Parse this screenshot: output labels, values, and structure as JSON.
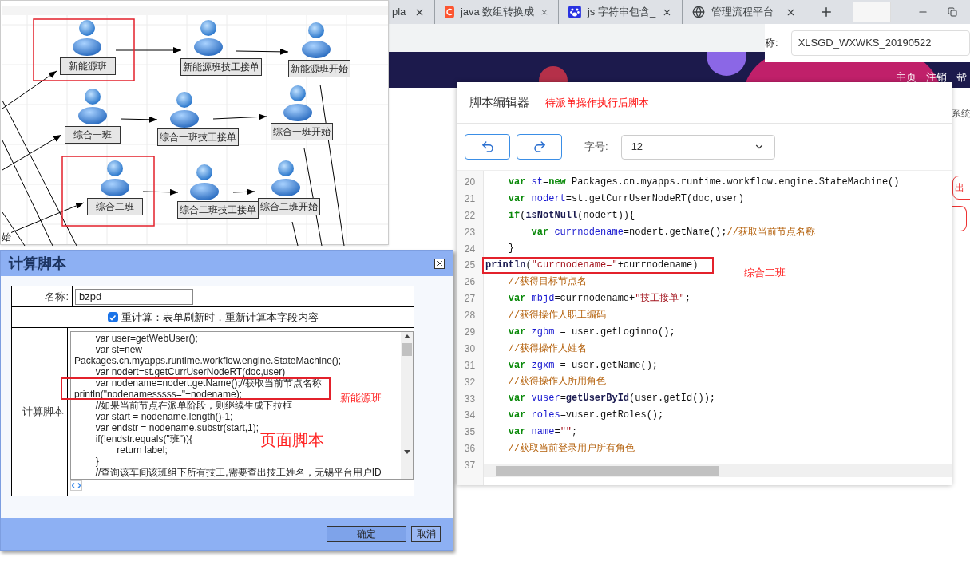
{
  "browser": {
    "tabs": [
      {
        "kind": "plain",
        "title": "pla"
      },
      {
        "kind": "c-logo",
        "title": "java 数组转换成"
      },
      {
        "kind": "paw",
        "title": "js 字符串包含_"
      },
      {
        "kind": "globe",
        "title": "管理流程平台"
      }
    ],
    "login": {
      "label": "称:",
      "value": "XLSGD_WXWKS_20190522"
    },
    "nav": [
      "主页",
      "注销",
      "帮"
    ],
    "side_text": "系统",
    "side_button": "出"
  },
  "diagram": {
    "nodes": [
      {
        "label": "新能源班",
        "highlighted": true
      },
      {
        "label": "新能源班技工接单",
        "highlighted": false
      },
      {
        "label": "新能源班开始",
        "highlighted": false
      },
      {
        "label": "综合一班",
        "highlighted": false
      },
      {
        "label": "综合一班技工接单",
        "highlighted": false
      },
      {
        "label": "综合一班开始",
        "highlighted": false
      },
      {
        "label": "综合二班",
        "highlighted": true
      },
      {
        "label": "综合二班技工接单",
        "highlighted": false
      },
      {
        "label": "综合二班开始",
        "highlighted": false
      }
    ],
    "edge_text": "始"
  },
  "calc_dialog": {
    "title": "计算脚本",
    "name_label": "名称:",
    "name_value": "bzpd",
    "recalc": {
      "checked": true,
      "label": "重计算：表单刷新时，重新计算本字段内容"
    },
    "script_label": "计算脚本",
    "script_lines": [
      "        var user=getWebUser();",
      "        var st=new",
      "Packages.cn.myapps.runtime.workflow.engine.StateMachine();",
      "        var nodert=st.getCurrUserNodeRT(doc,user)",
      "        var nodename=nodert.getName();//获取当前节点名称",
      "println(\"nodenamesssss=\"+nodename);",
      "        //如果当前节点在派单阶段，则继续生成下拉框",
      "        var start = nodename.length()-1;",
      "        var endstr = nodename.substr(start,1);",
      "        if(!endstr.equals(\"班\")){",
      "                return label;",
      "        }",
      "        //查询该车间该班组下所有技工,需要查出技工姓名，无锡平台用户ID"
    ],
    "annotation": "新能源班",
    "big_annotation": "页面脚本",
    "buttons": [
      "确定",
      "取消"
    ]
  },
  "editor": {
    "title": "脚本编辑器",
    "subtitle": "待派单操作执行后脚本",
    "font_label": "字号:",
    "font_size": "12",
    "annotation": "综合二班",
    "lines": [
      {
        "number": "20",
        "highlighted": false,
        "tokens": [
          {
            "kind": "keyword",
            "t": "    var "
          },
          {
            "kind": "variable",
            "t": "st"
          },
          {
            "kind": "plain",
            "t": "="
          },
          {
            "kind": "keyword",
            "t": "new"
          },
          {
            "kind": "plain",
            "t": " Packages.cn.myapps.runtime.workflow.engine.StateMachine()"
          }
        ]
      },
      {
        "number": "21",
        "highlighted": false,
        "tokens": [
          {
            "kind": "keyword",
            "t": "    var "
          },
          {
            "kind": "variable",
            "t": "nodert"
          },
          {
            "kind": "plain",
            "t": "=st.getCurrUserNodeRT(doc,user)"
          }
        ]
      },
      {
        "number": "22",
        "highlighted": false,
        "tokens": [
          {
            "kind": "keyword",
            "t": "    if"
          },
          {
            "kind": "plain",
            "t": "("
          },
          {
            "kind": "function",
            "t": "isNotNull"
          },
          {
            "kind": "plain",
            "t": "(nodert)){"
          }
        ]
      },
      {
        "number": "23",
        "highlighted": false,
        "tokens": [
          {
            "kind": "keyword",
            "t": "        var "
          },
          {
            "kind": "variable",
            "t": "currnodename"
          },
          {
            "kind": "plain",
            "t": "=nodert.getName();"
          },
          {
            "kind": "comment",
            "t": "//获取当前节点名称"
          }
        ]
      },
      {
        "number": "24",
        "highlighted": false,
        "tokens": [
          {
            "kind": "plain",
            "t": "    }"
          }
        ]
      },
      {
        "number": "25",
        "highlighted": true,
        "tokens": [
          {
            "kind": "function",
            "t": "println"
          },
          {
            "kind": "plain",
            "t": "("
          },
          {
            "kind": "string",
            "t": "\"currnodename=\""
          },
          {
            "kind": "plain",
            "t": "+currnodename)"
          }
        ]
      },
      {
        "number": "26",
        "highlighted": false,
        "tokens": [
          {
            "kind": "comment",
            "t": "    //获得目标节点名"
          }
        ]
      },
      {
        "number": "27",
        "highlighted": false,
        "tokens": [
          {
            "kind": "keyword",
            "t": "    var "
          },
          {
            "kind": "variable",
            "t": "mbjd"
          },
          {
            "kind": "plain",
            "t": "=currnodename+"
          },
          {
            "kind": "string",
            "t": "\"技工接单\""
          },
          {
            "kind": "plain",
            "t": ";"
          }
        ]
      },
      {
        "number": "28",
        "highlighted": false,
        "tokens": [
          {
            "kind": "comment",
            "t": "    //获得操作人职工编码"
          }
        ]
      },
      {
        "number": "29",
        "highlighted": false,
        "tokens": [
          {
            "kind": "keyword",
            "t": "    var "
          },
          {
            "kind": "variable",
            "t": "zgbm"
          },
          {
            "kind": "plain",
            "t": " = user.getLoginno();"
          }
        ]
      },
      {
        "number": "30",
        "highlighted": false,
        "tokens": [
          {
            "kind": "comment",
            "t": "    //获得操作人姓名"
          }
        ]
      },
      {
        "number": "31",
        "highlighted": false,
        "tokens": [
          {
            "kind": "keyword",
            "t": "    var "
          },
          {
            "kind": "variable",
            "t": "zgxm"
          },
          {
            "kind": "plain",
            "t": " = user.getName();"
          }
        ]
      },
      {
        "number": "32",
        "highlighted": false,
        "tokens": [
          {
            "kind": "comment",
            "t": "    //获得操作人所用角色"
          }
        ]
      },
      {
        "number": "33",
        "highlighted": false,
        "tokens": [
          {
            "kind": "keyword",
            "t": "    var "
          },
          {
            "kind": "variable",
            "t": "vuser"
          },
          {
            "kind": "plain",
            "t": "="
          },
          {
            "kind": "function",
            "t": "getUserById"
          },
          {
            "kind": "plain",
            "t": "(user.getId());"
          }
        ]
      },
      {
        "number": "34",
        "highlighted": false,
        "tokens": [
          {
            "kind": "keyword",
            "t": "    var "
          },
          {
            "kind": "variable",
            "t": "roles"
          },
          {
            "kind": "plain",
            "t": "=vuser.getRoles();"
          }
        ]
      },
      {
        "number": "35",
        "highlighted": false,
        "tokens": [
          {
            "kind": "keyword",
            "t": "    var "
          },
          {
            "kind": "variable",
            "t": "name"
          },
          {
            "kind": "plain",
            "t": "="
          },
          {
            "kind": "string",
            "t": "\"\""
          },
          {
            "kind": "plain",
            "t": ";"
          }
        ]
      },
      {
        "number": "36",
        "highlighted": false,
        "tokens": [
          {
            "kind": "comment",
            "t": "    //获取当前登录用户所有角色"
          }
        ]
      },
      {
        "number": "37"
      }
    ]
  }
}
